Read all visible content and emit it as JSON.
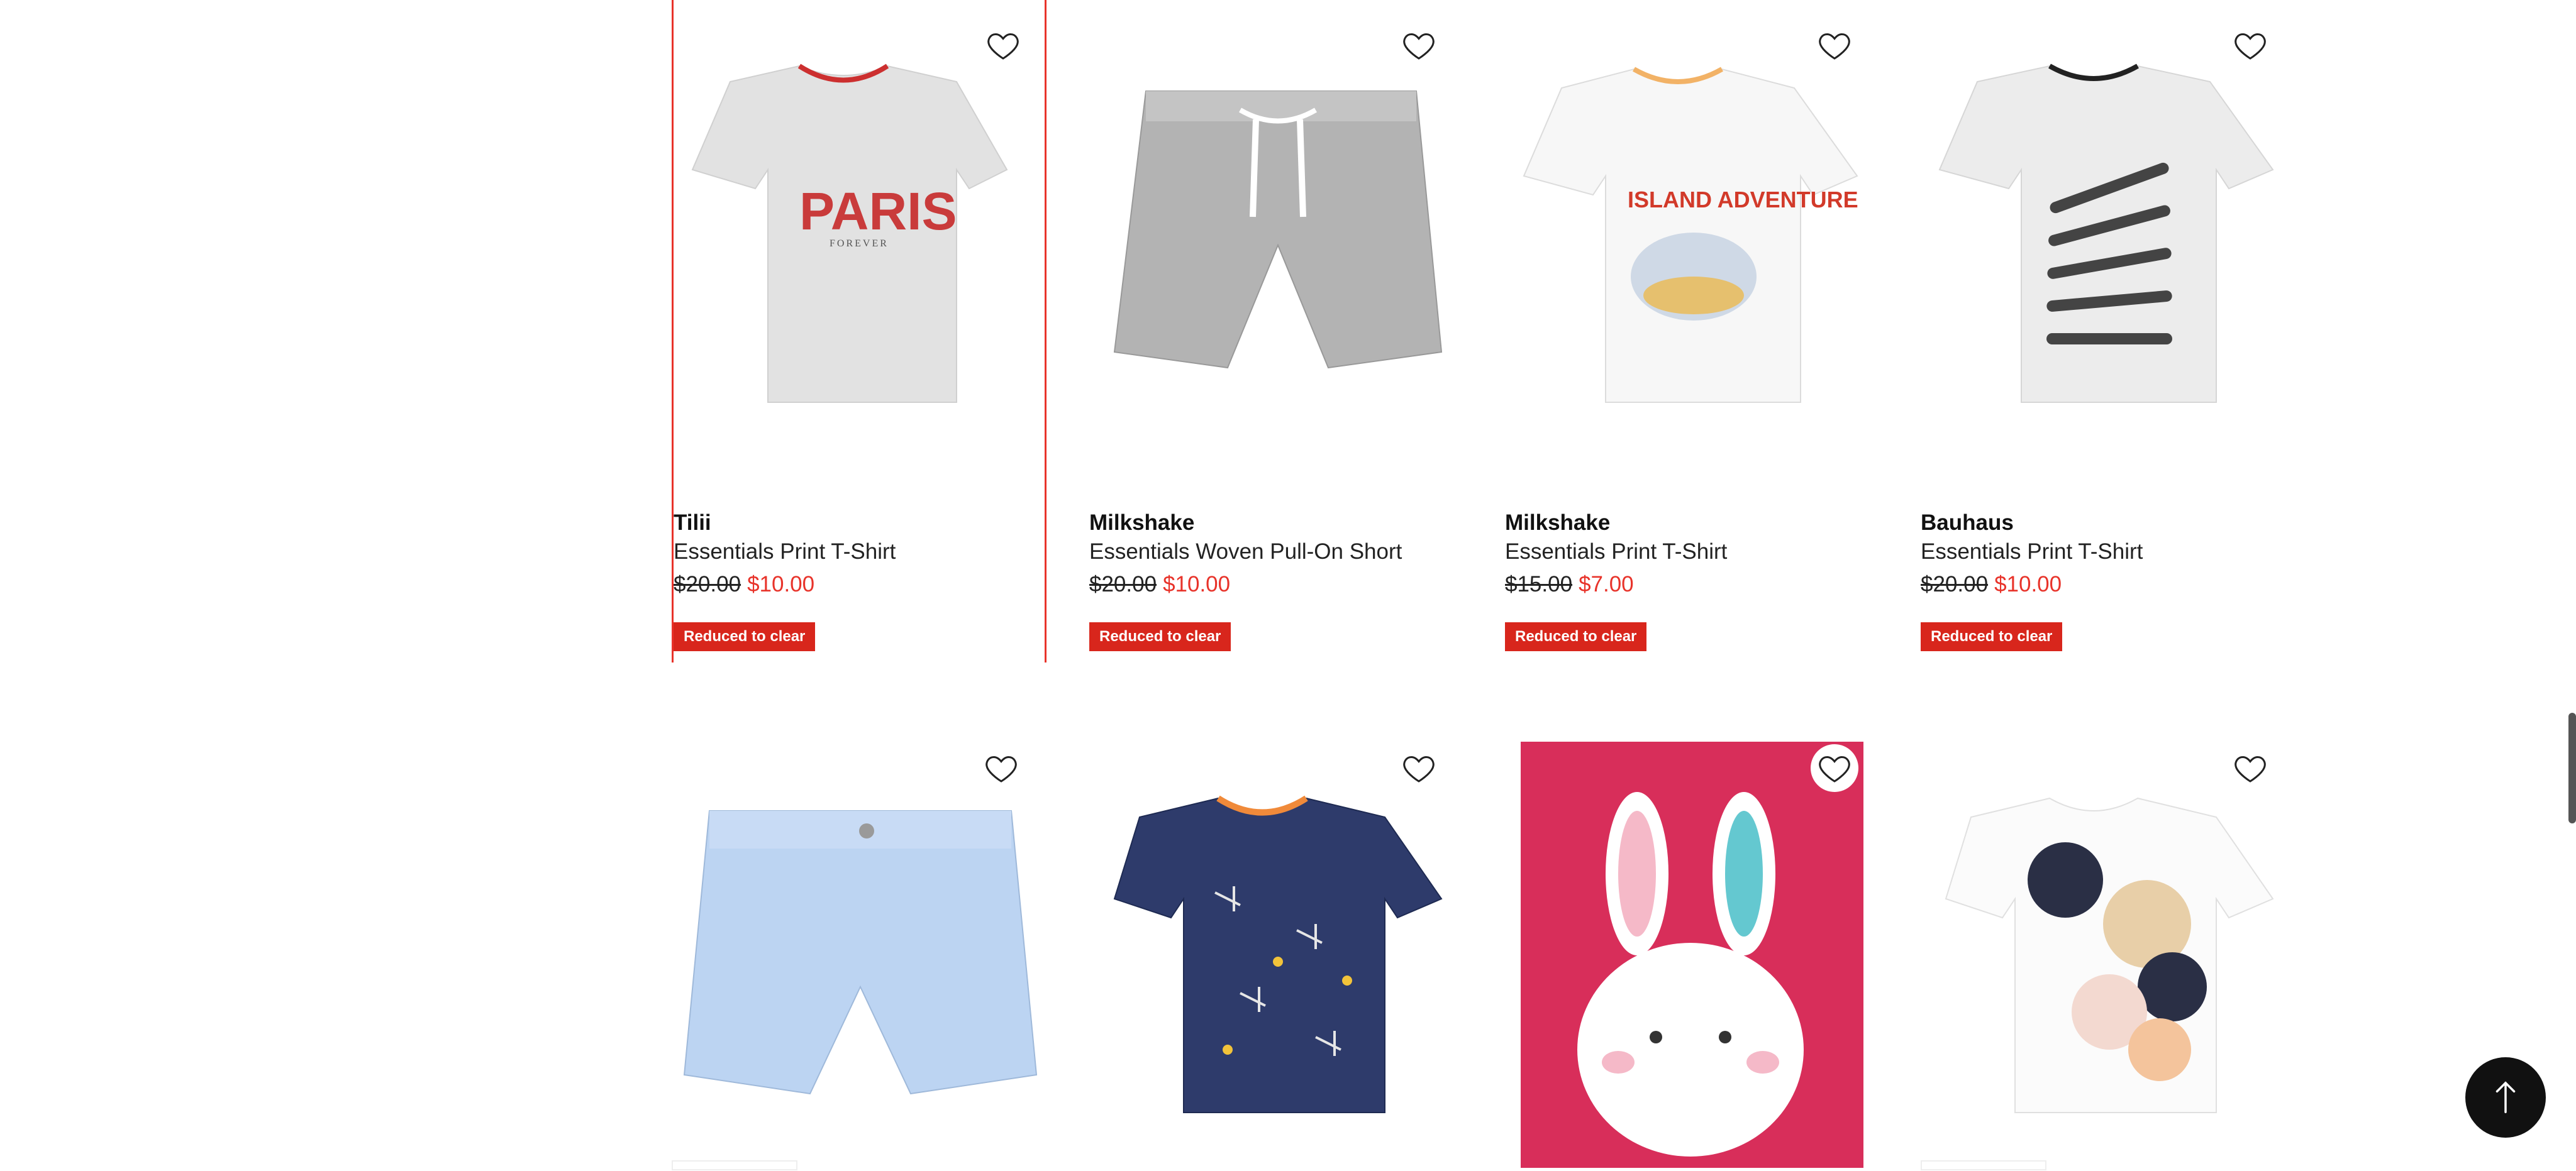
{
  "colors": {
    "accent": "#e8332a",
    "badge": "#d8261c",
    "text": "#111111"
  },
  "products": [
    {
      "brand": "Tilii",
      "name": "Essentials Print T-Shirt",
      "was_price": "$20.00",
      "now_price": "$10.00",
      "badge": "Reduced to clear",
      "image": "tshirt-paris-forever",
      "image_text": "PARIS",
      "image_subtext": "FOREVER"
    },
    {
      "brand": "Milkshake",
      "name": "Essentials Woven Pull-On Short",
      "was_price": "$20.00",
      "now_price": "$10.00",
      "badge": "Reduced to clear",
      "image": "grey-pull-on-shorts"
    },
    {
      "brand": "Milkshake",
      "name": "Essentials Print T-Shirt",
      "was_price": "$15.00",
      "now_price": "$7.00",
      "badge": "Reduced to clear",
      "image": "tshirt-island-adventure",
      "image_text": "ISLAND ADVENTURE"
    },
    {
      "brand": "Bauhaus",
      "name": "Essentials Print T-Shirt",
      "was_price": "$20.00",
      "now_price": "$10.00",
      "badge": "Reduced to clear",
      "image": "tshirt-skateboards"
    },
    {
      "image": "blue-chino-shorts"
    },
    {
      "image": "navy-planes-tshirt"
    },
    {
      "image": "bunny-print-pink"
    },
    {
      "image": "dots-tshirt-white"
    }
  ],
  "icons": {
    "favourite": "heart-outline-icon",
    "back_to_top": "arrow-up-icon"
  }
}
